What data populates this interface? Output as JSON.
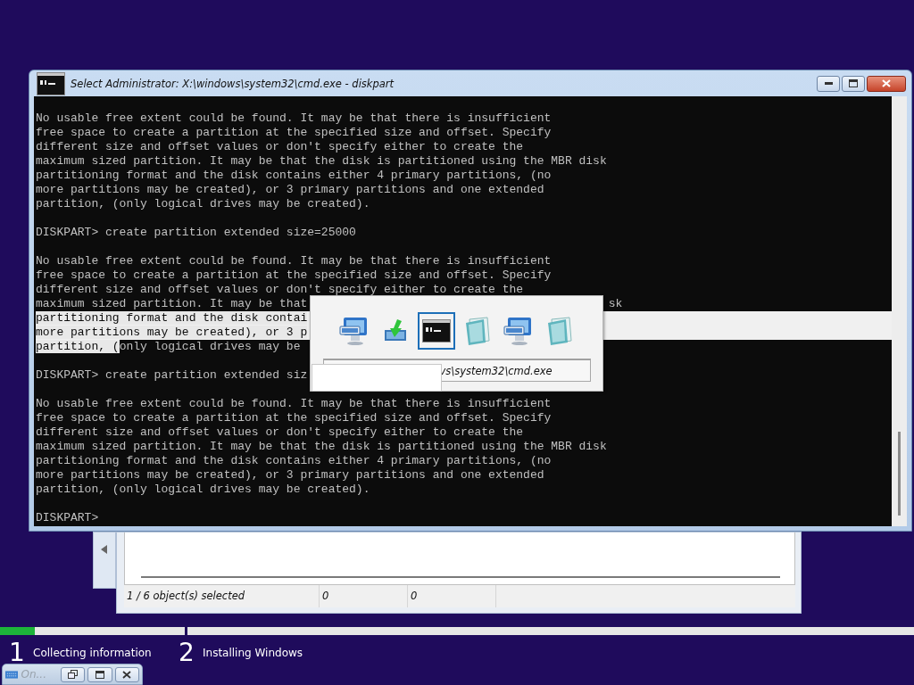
{
  "window": {
    "title": "Select Administrator: X:\\windows\\system32\\cmd.exe - diskpart",
    "console": {
      "lines": [
        {
          "kind": "text",
          "segments": [
            {
              "text": "No usable free extent could be found. It may be that there is insufficient",
              "selected": false
            }
          ]
        },
        {
          "kind": "text",
          "segments": [
            {
              "text": "free space to create a partition at the specified size and offset. Specify",
              "selected": false
            }
          ]
        },
        {
          "kind": "text",
          "segments": [
            {
              "text": "different size and offset values or don't specify either to create the",
              "selected": false
            }
          ]
        },
        {
          "kind": "text",
          "segments": [
            {
              "text": "maximum sized partition. It may be that the disk is partitioned using the MBR disk",
              "selected": false
            }
          ]
        },
        {
          "kind": "text",
          "segments": [
            {
              "text": "partitioning format and the disk contains either 4 primary partitions, (no",
              "selected": false
            }
          ]
        },
        {
          "kind": "text",
          "segments": [
            {
              "text": "more partitions may be created), or 3 primary partitions and one extended",
              "selected": false
            }
          ]
        },
        {
          "kind": "text",
          "segments": [
            {
              "text": "partition, (only logical drives may be created).",
              "selected": false
            }
          ]
        },
        {
          "kind": "blank"
        },
        {
          "kind": "text",
          "segments": [
            {
              "text": "DISKPART> create partition extended size=25000",
              "selected": false
            }
          ]
        },
        {
          "kind": "blank"
        },
        {
          "kind": "text",
          "segments": [
            {
              "text": "No usable free extent could be found. It may be that there is insufficient",
              "selected": false
            }
          ]
        },
        {
          "kind": "text",
          "segments": [
            {
              "text": "free space to create a partition at the specified size and offset. Specify",
              "selected": false
            }
          ]
        },
        {
          "kind": "text",
          "segments": [
            {
              "text": "different size and offset values or don't specify either to create the",
              "selected": false
            }
          ]
        },
        {
          "kind": "text",
          "segments": [
            {
              "text": "maximum sized partition. It may be that",
              "selected": false
            }
          ],
          "right": "sk"
        },
        {
          "kind": "text",
          "selected": true,
          "segments": [
            {
              "text": "partitioning format and the disk contai",
              "selected": true
            }
          ]
        },
        {
          "kind": "text",
          "selected": true,
          "segments": [
            {
              "text": "more partitions may be created), or 3 p",
              "selected": true
            }
          ]
        },
        {
          "kind": "text",
          "segments": [
            {
              "text": "partition, (",
              "selected": true
            },
            {
              "text": "only logical drives may be",
              "selected": false
            }
          ]
        },
        {
          "kind": "blank"
        },
        {
          "kind": "text",
          "segments": [
            {
              "text": "DISKPART> create partition extended siz",
              "selected": false
            }
          ]
        },
        {
          "kind": "blank"
        },
        {
          "kind": "text",
          "segments": [
            {
              "text": "No usable free extent could be found. It may be that there is insufficient",
              "selected": false
            }
          ]
        },
        {
          "kind": "text",
          "segments": [
            {
              "text": "free space to create a partition at the specified size and offset. Specify",
              "selected": false
            }
          ]
        },
        {
          "kind": "text",
          "segments": [
            {
              "text": "different size and offset values or don't specify either to create the",
              "selected": false
            }
          ]
        },
        {
          "kind": "text",
          "segments": [
            {
              "text": "maximum sized partition. It may be that the disk is partitioned using the MBR disk",
              "selected": false
            }
          ]
        },
        {
          "kind": "text",
          "segments": [
            {
              "text": "partitioning format and the disk contains either 4 primary partitions, (no",
              "selected": false
            }
          ]
        },
        {
          "kind": "text",
          "segments": [
            {
              "text": "more partitions may be created), or 3 primary partitions and one extended",
              "selected": false
            }
          ]
        },
        {
          "kind": "text",
          "segments": [
            {
              "text": "partition, (only logical drives may be created).",
              "selected": false
            }
          ]
        },
        {
          "kind": "blank"
        },
        {
          "kind": "text",
          "segments": [
            {
              "text": "DISKPART>",
              "selected": false
            }
          ]
        }
      ]
    }
  },
  "switcher": {
    "items": [
      {
        "kind": "keyboard-monitor",
        "selected": false
      },
      {
        "kind": "install",
        "selected": false
      },
      {
        "kind": "console",
        "selected": true
      },
      {
        "kind": "notepad",
        "selected": false
      },
      {
        "kind": "keyboard-monitor",
        "selected": false
      },
      {
        "kind": "notepad",
        "selected": false
      }
    ],
    "caption": "vs\\system32\\cmd.exe"
  },
  "background_window": {
    "status_bar": [
      "1 / 6 object(s) selected",
      "0",
      "0"
    ]
  },
  "setup": {
    "steps": [
      {
        "number": "1",
        "label": "Collecting information",
        "level": 0.19
      },
      {
        "number": "2",
        "label": "Installing Windows"
      }
    ]
  },
  "minimized_bar": {
    "title": "On...",
    "disabled": true
  }
}
